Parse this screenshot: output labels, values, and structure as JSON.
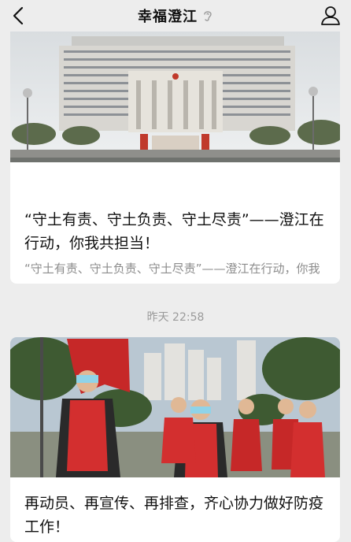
{
  "nav": {
    "title": "幸福澄江"
  },
  "icons": {
    "back": "chevron-left-icon",
    "voice": "ear-icon",
    "profile": "person-icon"
  },
  "articles": [
    {
      "title": "“守土有责、守土负责、守土尽责”——澄江在行动，你我共担当！",
      "description": "“守土有责、守土负责、守土尽责”——澄江在行动，你我共担当！"
    },
    {
      "title": "再动员、再宣传、再排查，齐心协力做好防疫工作！"
    }
  ],
  "timestamp": "昨天 22:58"
}
